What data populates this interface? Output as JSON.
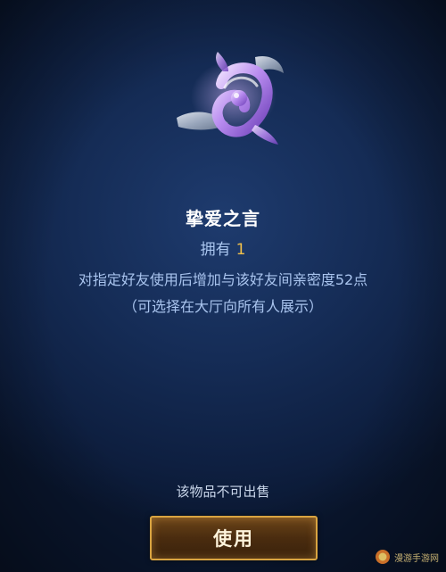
{
  "item": {
    "name": "挚爱之言",
    "owned_label": "拥有",
    "owned_count": "1",
    "description_line1": "对指定好友使用后增加与该好友间亲密度52点",
    "description_line2": "（可选择在大厅向所有人展示）",
    "art_icon": "ribbon-gift-icon"
  },
  "footer": {
    "not_sellable": "该物品不可出售",
    "use_button": "使用"
  },
  "watermark": {
    "text": "漫游手游网"
  },
  "colors": {
    "background": "#152c56",
    "title": "#ffffff",
    "body_text": "#a9c4ee",
    "accent_count": "#f2c14a",
    "button_border": "#d9a441"
  }
}
